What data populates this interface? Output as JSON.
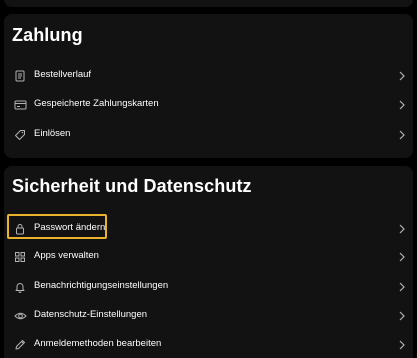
{
  "payment": {
    "title": "Zahlung",
    "items": [
      {
        "label": "Bestellverlauf",
        "icon": "receipt-icon"
      },
      {
        "label": "Gespeicherte Zahlungskarten",
        "icon": "credit-card-icon"
      },
      {
        "label": "Einlösen",
        "icon": "tag-icon"
      }
    ]
  },
  "security": {
    "title": "Sicherheit und Datenschutz",
    "items": [
      {
        "label": "Passwort ändern",
        "icon": "lock-icon",
        "highlighted": true
      },
      {
        "label": "Apps verwalten",
        "icon": "apps-grid-icon"
      },
      {
        "label": "Benachrichtigungseinstellungen",
        "icon": "bell-icon"
      },
      {
        "label": "Datenschutz-Einstellungen",
        "icon": "eye-icon"
      },
      {
        "label": "Anmeldemethoden bearbeiten",
        "icon": "pencil-icon"
      }
    ]
  },
  "colors": {
    "background": "#000000",
    "card": "#121212",
    "text": "#ffffff",
    "icon": "#b3b3b3",
    "highlight": "#e8b22c"
  }
}
